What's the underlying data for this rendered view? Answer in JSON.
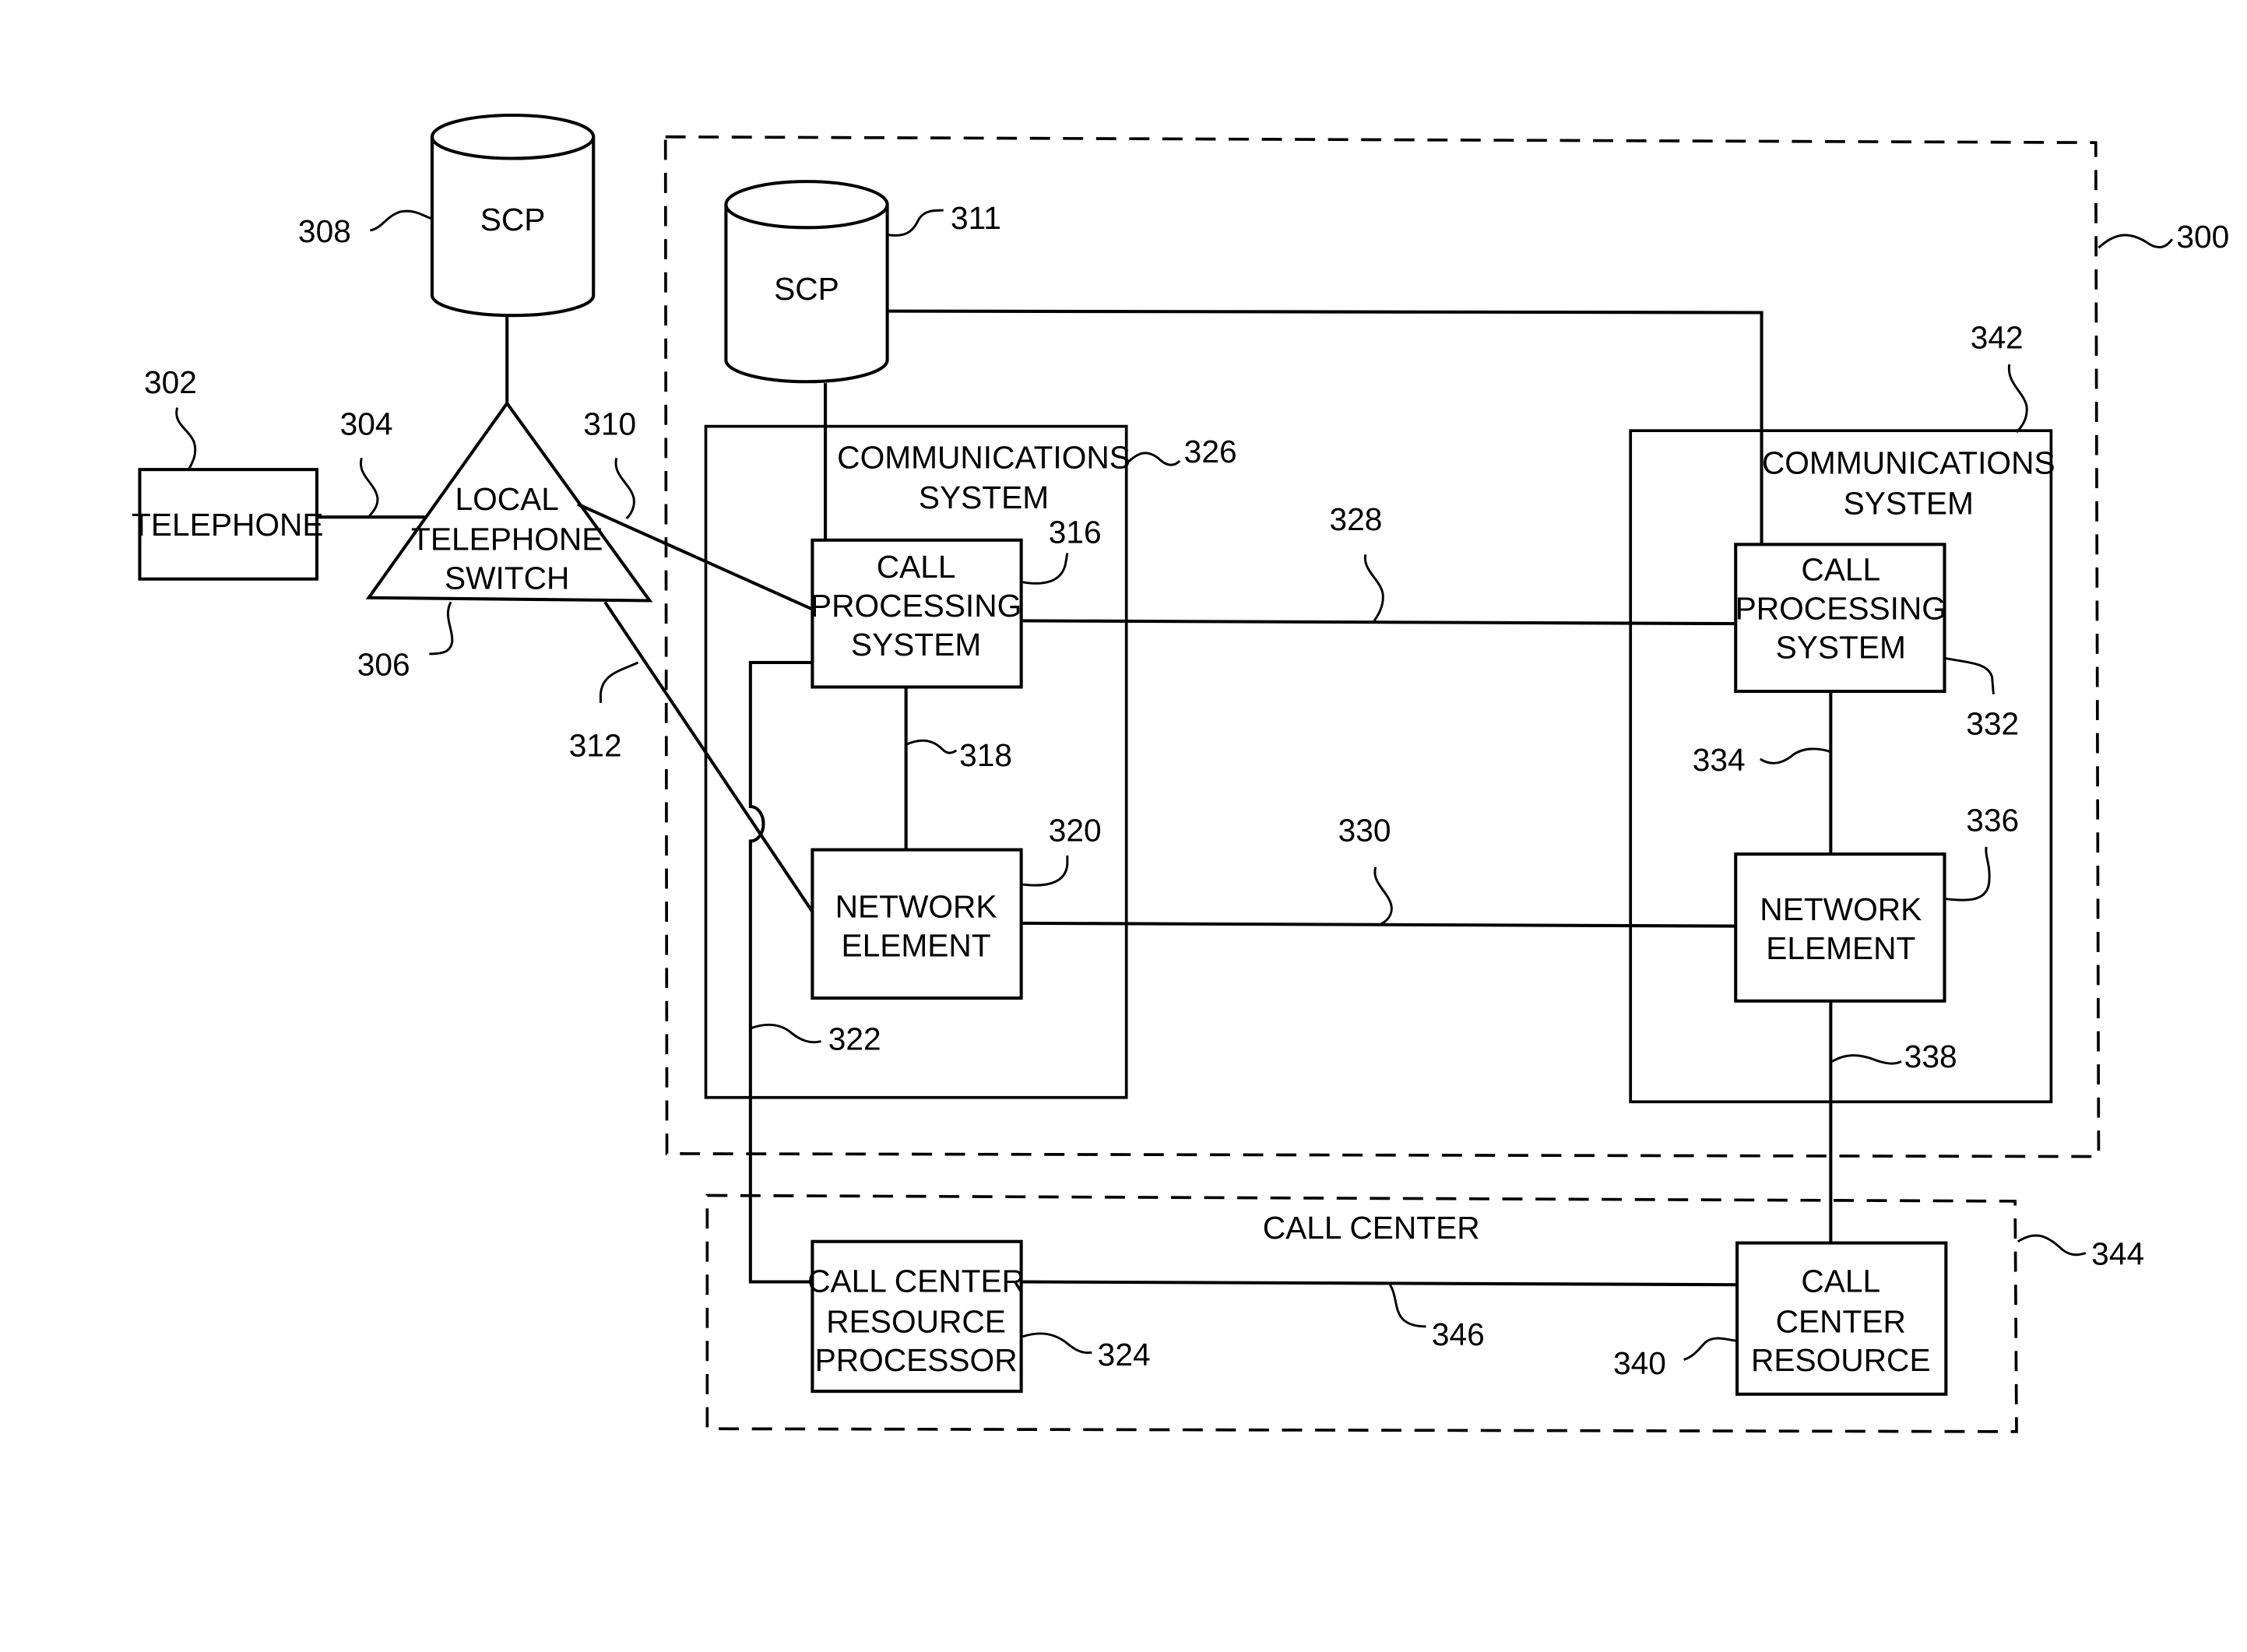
{
  "figure": {
    "system_ref": "300",
    "nodes": {
      "telephone": {
        "ref": "302",
        "lines": [
          "TELEPHONE"
        ]
      },
      "local_switch": {
        "ref": "306",
        "lines": [
          "LOCAL",
          "TELEPHONE",
          "SWITCH"
        ]
      },
      "scp_external": {
        "ref": "308",
        "lines": [
          "SCP"
        ]
      },
      "scp_internal": {
        "ref": "311",
        "lines": [
          "SCP"
        ]
      },
      "comm_system_1": {
        "ref": "326",
        "lines": [
          "COMMUNICATIONS",
          "SYSTEM"
        ]
      },
      "call_processing_1": {
        "ref": "316",
        "lines": [
          "CALL",
          "PROCESSING",
          "SYSTEM"
        ]
      },
      "network_element_1": {
        "ref": "320",
        "lines": [
          "NETWORK",
          "ELEMENT"
        ]
      },
      "comm_system_2": {
        "ref": "342",
        "lines": [
          "COMMUNICATIONS",
          "SYSTEM"
        ]
      },
      "call_processing_2": {
        "ref": "332",
        "lines": [
          "CALL",
          "PROCESSING",
          "SYSTEM"
        ]
      },
      "network_element_2": {
        "ref": "336",
        "lines": [
          "NETWORK",
          "ELEMENT"
        ]
      },
      "call_center": {
        "ref": "344",
        "lines": [
          "CALL CENTER"
        ]
      },
      "cc_resource_processor": {
        "ref": "324",
        "lines": [
          "CALL CENTER",
          "RESOURCE",
          "PROCESSOR"
        ]
      },
      "cc_resource": {
        "ref": "340",
        "lines": [
          "CALL",
          "CENTER",
          "RESOURCE"
        ]
      }
    },
    "links": {
      "phone_to_switch": "304",
      "switch_to_cps": "310",
      "switch_to_ne": "312",
      "cps_to_ne_1": "318",
      "cps_to_ccrp": "322",
      "cps_to_cps": "328",
      "ne_to_ne": "330",
      "cps_to_ne_2": "334",
      "ne_to_ccr": "338",
      "ccrp_to_ccr": "346"
    }
  }
}
